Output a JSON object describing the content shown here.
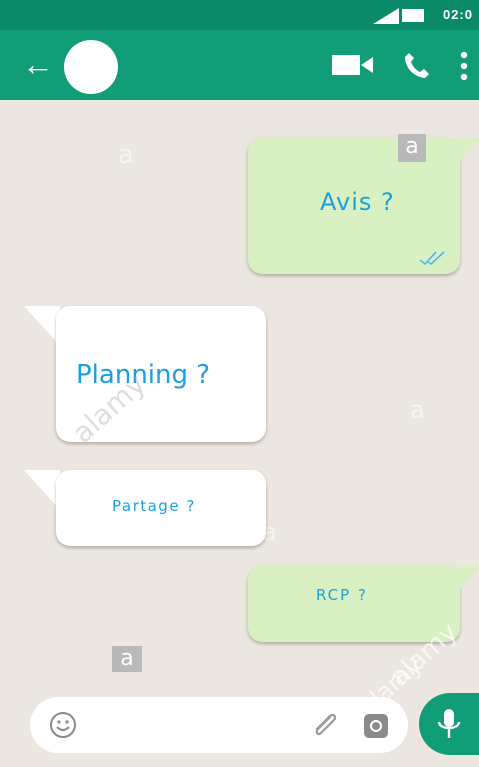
{
  "status_bar": {
    "time": "02:0"
  },
  "header": {
    "back_icon": "arrow-left",
    "icons": [
      "video-camera-icon",
      "phone-icon",
      "more-vertical-icon"
    ]
  },
  "messages": [
    {
      "direction": "outgoing",
      "text": "Avis ?",
      "read_receipt": "double-check"
    },
    {
      "direction": "incoming",
      "text": "Planning ?"
    },
    {
      "direction": "incoming",
      "text": "Partage ?"
    },
    {
      "direction": "outgoing",
      "text": "RCP ?"
    }
  ],
  "watermark": {
    "text": "alamy",
    "letter": "a"
  },
  "colors": {
    "header": "#109d78",
    "status_bar": "#0b8a6a",
    "outgoing_bubble": "#d8f0c2",
    "incoming_bubble": "#ffffff",
    "message_text": "#1a9fe0",
    "chat_background": "#ebe6df"
  }
}
